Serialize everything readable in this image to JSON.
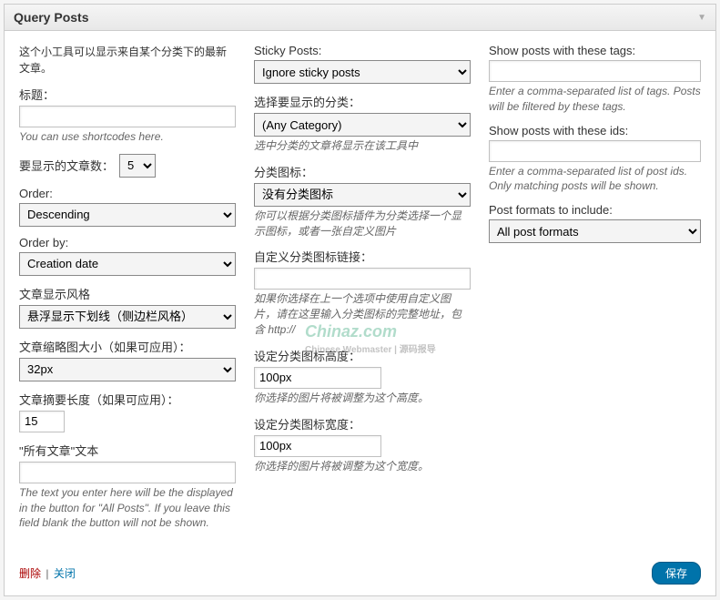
{
  "header": {
    "title": "Query Posts"
  },
  "col1": {
    "intro": "这个小工具可以显示来自某个分类下的最新文章。",
    "title_label": "标题：",
    "title_value": "",
    "title_help": "You can use shortcodes here.",
    "count_label": "要显示的文章数：",
    "count_value": "5",
    "order_label": "Order:",
    "order_value": "Descending",
    "orderby_label": "Order by:",
    "orderby_value": "Creation date",
    "style_label": "文章显示风格",
    "style_value": "悬浮显示下划线（侧边栏风格）",
    "thumb_label": "文章缩略图大小（如果可应用）：",
    "thumb_value": "32px",
    "excerpt_label": "文章摘要长度（如果可应用）：",
    "excerpt_value": "15",
    "allposts_label": "\"所有文章\"文本",
    "allposts_value": "",
    "allposts_help": "The text you enter here will be the displayed in the button for \"All Posts\". If you leave this field blank the button will not be shown."
  },
  "col2": {
    "sticky_label": "Sticky Posts:",
    "sticky_value": "Ignore sticky posts",
    "category_label": "选择要显示的分类：",
    "category_value": "(Any Category)",
    "category_help": "选中分类的文章将显示在该工具中",
    "icon_label": "分类图标：",
    "icon_value": "没有分类图标",
    "icon_help": "你可以根据分类图标插件为分类选择一个显示图标，或者一张自定义图片",
    "link_label": "自定义分类图标链接：",
    "link_value": "",
    "link_help": "如果你选择在上一个选项中使用自定义图片，请在这里输入分类图标的完整地址，包含 http://",
    "height_label": "设定分类图标高度：",
    "height_value": "100px",
    "height_help": "你选择的图片将被调整为这个高度。",
    "width_label": "设定分类图标宽度：",
    "width_value": "100px",
    "width_help": "你选择的图片将被调整为这个宽度。"
  },
  "col3": {
    "tags_label": "Show posts with these tags:",
    "tags_value": "",
    "tags_help": "Enter a comma-separated list of tags. Posts will be filtered by these tags.",
    "ids_label": "Show posts with these ids:",
    "ids_value": "",
    "ids_help": "Enter a comma-separated list of post ids. Only matching posts will be shown.",
    "formats_label": "Post formats to include:",
    "formats_value": "All post formats"
  },
  "footer": {
    "delete": "删除",
    "close": "关闭",
    "save": "保存"
  },
  "watermark": {
    "main": "Chinaz.com",
    "sub": "Chinese Webmaster | 源码报导"
  }
}
